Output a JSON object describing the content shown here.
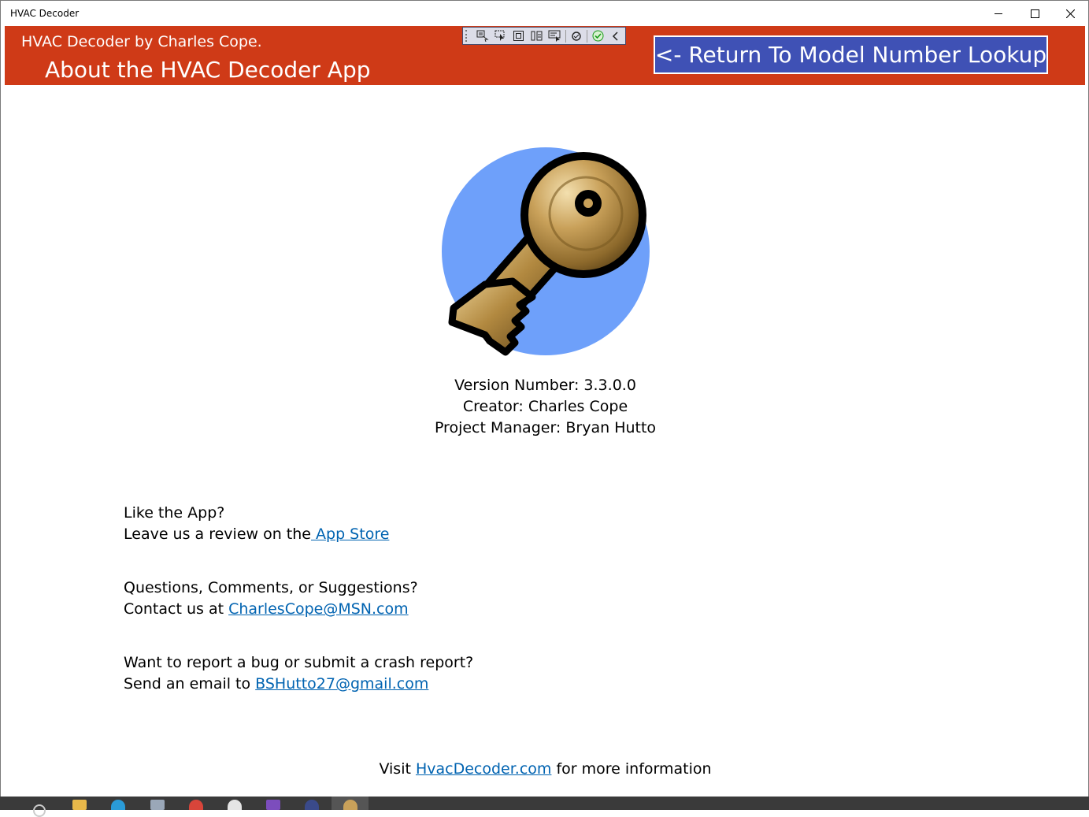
{
  "window": {
    "title": "HVAC Decoder"
  },
  "header": {
    "subtitle": "HVAC Decoder by Charles Cope.",
    "title": "About the HVAC Decoder App",
    "return_button": "<- Return To Model Number Lookup",
    "color": "#cf3a17",
    "button_color": "#3f51b5"
  },
  "info": {
    "version": "Version Number: 3.3.0.0",
    "creator": "Creator: Charles Cope",
    "project_manager": "Project Manager: Bryan Hutto"
  },
  "review": {
    "question": "Like the App?",
    "prefix": "Leave us a review on the",
    "link": " App Store"
  },
  "contact": {
    "question": "Questions, Comments, or Suggestions?",
    "prefix": "Contact us at ",
    "link": "CharlesCope@MSN.com"
  },
  "bug": {
    "question": "Want to report a bug or submit a crash report?",
    "prefix": "Send an email to ",
    "link": "BSHutto27@gmail.com"
  },
  "visit": {
    "prefix": "Visit ",
    "link": "HvacDecoder.com",
    "suffix": " for more information"
  },
  "icons": {
    "logo": "key-icon",
    "toolbar": [
      "live-visual-tree-icon",
      "select-element-icon",
      "display-layout-adorners-icon",
      "track-focus-icon",
      "preview-selection-icon",
      "hot-reload-icon",
      "binding-failures-icon",
      "collapse-toolbar-icon"
    ]
  },
  "colors": {
    "link": "#0063b1",
    "logo_circle": "#6ea0fa"
  }
}
